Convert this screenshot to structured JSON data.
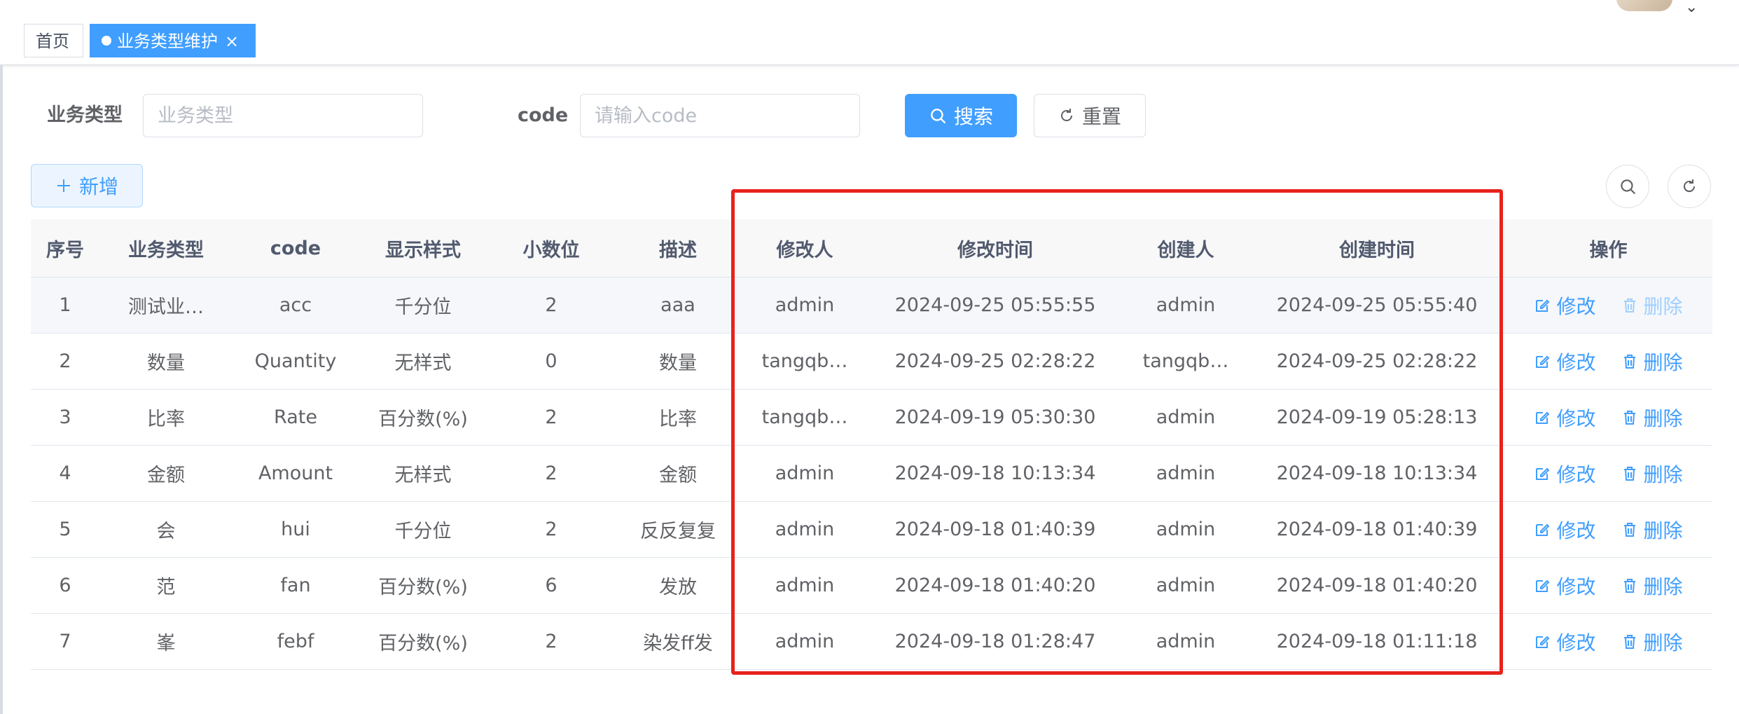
{
  "tags": {
    "home": "首页",
    "active": "业务类型维护",
    "active_close": "×"
  },
  "search": {
    "type_label": "业务类型",
    "type_placeholder": "业务类型",
    "type_value": "",
    "code_label": "code",
    "code_placeholder": "请输入code",
    "code_value": "",
    "search_button": "搜索",
    "reset_button": "重置"
  },
  "toolbar": {
    "add_button": "新增"
  },
  "table": {
    "columns": [
      "序号",
      "业务类型",
      "code",
      "显示样式",
      "小数位",
      "描述",
      "修改人",
      "修改时间",
      "创建人",
      "创建时间",
      "操作"
    ],
    "rows": [
      {
        "index": "1",
        "type": "测试业…",
        "code": "acc",
        "style": "千分位",
        "decimals": "2",
        "desc": "aaa",
        "modifier": "admin",
        "modified_at": "2024-09-25 05:55:55",
        "creator": "admin",
        "created_at": "2024-09-25 05:55:40",
        "edit": "修改",
        "delete": "删除",
        "delete_disabled": true
      },
      {
        "index": "2",
        "type": "数量",
        "code": "Quantity",
        "style": "无样式",
        "decimals": "0",
        "desc": "数量",
        "modifier": "tangqb…",
        "modified_at": "2024-09-25 02:28:22",
        "creator": "tangqb…",
        "created_at": "2024-09-25 02:28:22",
        "edit": "修改",
        "delete": "删除",
        "delete_disabled": false
      },
      {
        "index": "3",
        "type": "比率",
        "code": "Rate",
        "style": "百分数(%)",
        "decimals": "2",
        "desc": "比率",
        "modifier": "tangqb…",
        "modified_at": "2024-09-19 05:30:30",
        "creator": "admin",
        "created_at": "2024-09-19 05:28:13",
        "edit": "修改",
        "delete": "删除",
        "delete_disabled": false
      },
      {
        "index": "4",
        "type": "金额",
        "code": "Amount",
        "style": "无样式",
        "decimals": "2",
        "desc": "金额",
        "modifier": "admin",
        "modified_at": "2024-09-18 10:13:34",
        "creator": "admin",
        "created_at": "2024-09-18 10:13:34",
        "edit": "修改",
        "delete": "删除",
        "delete_disabled": false
      },
      {
        "index": "5",
        "type": "会",
        "code": "hui",
        "style": "千分位",
        "decimals": "2",
        "desc": "反反复复",
        "modifier": "admin",
        "modified_at": "2024-09-18 01:40:39",
        "creator": "admin",
        "created_at": "2024-09-18 01:40:39",
        "edit": "修改",
        "delete": "删除",
        "delete_disabled": false
      },
      {
        "index": "6",
        "type": "范",
        "code": "fan",
        "style": "百分数(%)",
        "decimals": "6",
        "desc": "发放",
        "modifier": "admin",
        "modified_at": "2024-09-18 01:40:20",
        "creator": "admin",
        "created_at": "2024-09-18 01:40:20",
        "edit": "修改",
        "delete": "删除",
        "delete_disabled": false
      },
      {
        "index": "7",
        "type": "峯",
        "code": "febf",
        "style": "百分数(%)",
        "decimals": "2",
        "desc": "染发ff发",
        "modifier": "admin",
        "modified_at": "2024-09-18 01:28:47",
        "creator": "admin",
        "created_at": "2024-09-18 01:11:18",
        "edit": "修改",
        "delete": "删除",
        "delete_disabled": false
      }
    ]
  },
  "colors": {
    "primary": "#409eff",
    "highlight_box": "#e8221c",
    "header_bg": "#f8f8f9"
  }
}
